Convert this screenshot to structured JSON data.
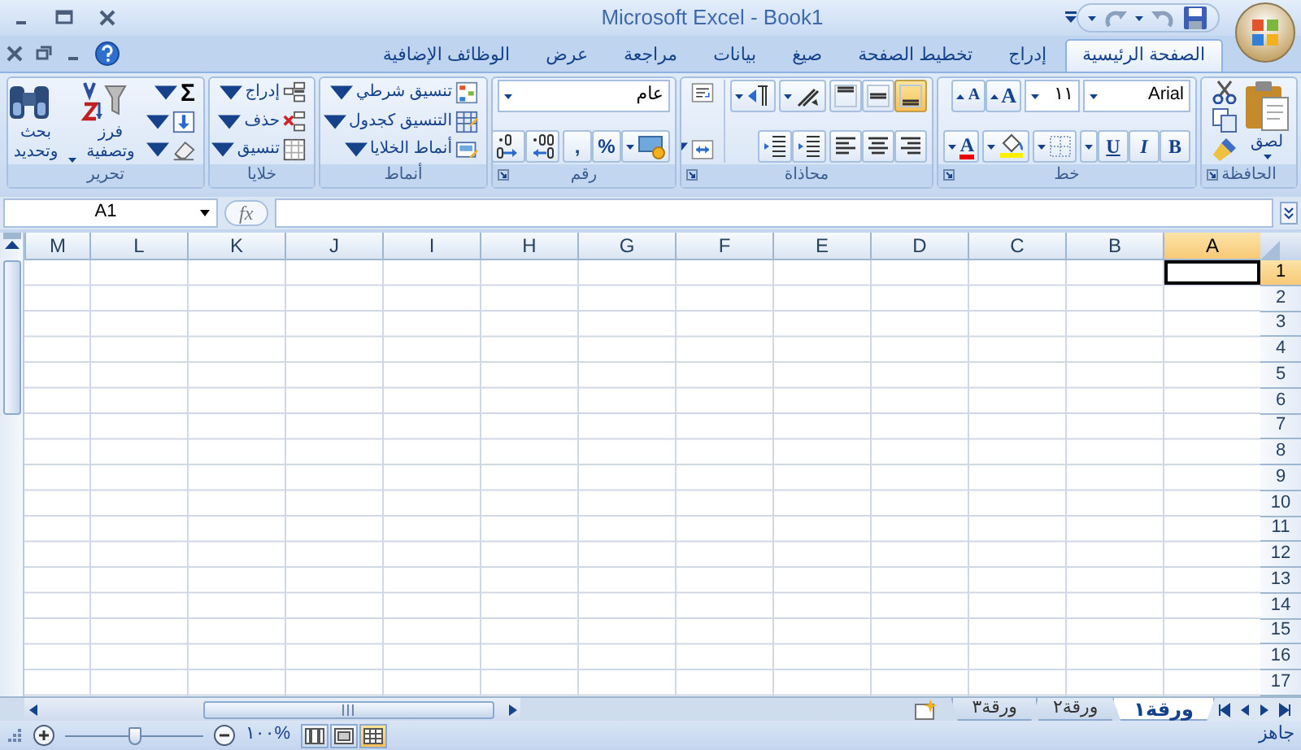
{
  "window": {
    "title": "Microsoft Excel - Book1"
  },
  "tabs": [
    {
      "label": "الصفحة الرئيسية",
      "selected": true
    },
    {
      "label": "إدراج",
      "selected": false
    },
    {
      "label": "تخطيط الصفحة",
      "selected": false
    },
    {
      "label": "صيغ",
      "selected": false
    },
    {
      "label": "بيانات",
      "selected": false
    },
    {
      "label": "مراجعة",
      "selected": false
    },
    {
      "label": "عرض",
      "selected": false
    },
    {
      "label": "الوظائف الإضافية",
      "selected": false
    }
  ],
  "ribbon": [
    {
      "kind": "clipboard",
      "title": "الحافظة",
      "paste_label": "لصق"
    },
    {
      "kind": "font",
      "title": "خط",
      "font_name": "Arial",
      "font_size": "١١",
      "grow_label": "A",
      "shrink_label": "A",
      "bold": "B",
      "italic": "I",
      "underline": "U",
      "font_color_label": "A"
    },
    {
      "kind": "alignment",
      "title": "محاذاة",
      "vertical_align": [
        {
          "kind": "bottom",
          "selected": true
        },
        {
          "kind": "middle",
          "selected": false
        },
        {
          "kind": "top",
          "selected": false
        }
      ],
      "horizontal_align": [
        {
          "kind": "right",
          "selected": false
        },
        {
          "kind": "center",
          "selected": false
        },
        {
          "kind": "left",
          "selected": false
        }
      ]
    },
    {
      "kind": "number",
      "title": "رقم",
      "format": "عام",
      "percent": "%",
      "comma": ","
    },
    {
      "kind": "styles",
      "title": "أنماط",
      "items": [
        "تنسيق شرطي",
        "التنسيق كجدول",
        "أنماط الخلايا"
      ]
    },
    {
      "kind": "cells",
      "title": "خلايا",
      "items": [
        "إدراج",
        "حذف",
        "تنسيق"
      ]
    },
    {
      "kind": "editing",
      "title": "تحرير",
      "sum": "Σ",
      "sort_label": "فرز وتصفية",
      "find_label": "بحث وتحديد"
    }
  ],
  "formula_bar": {
    "name_box": "A1",
    "fx": "fx"
  },
  "columns": [
    {
      "label": "A",
      "selected": true
    },
    {
      "label": "B",
      "selected": false
    },
    {
      "label": "C",
      "selected": false
    },
    {
      "label": "D",
      "selected": false
    },
    {
      "label": "E",
      "selected": false
    },
    {
      "label": "F",
      "selected": false
    },
    {
      "label": "G",
      "selected": false
    },
    {
      "label": "H",
      "selected": false
    },
    {
      "label": "I",
      "selected": false
    },
    {
      "label": "J",
      "selected": false
    },
    {
      "label": "K",
      "selected": false
    },
    {
      "label": "L",
      "selected": false
    },
    {
      "label": "M",
      "selected": false
    }
  ],
  "rows": [
    {
      "label": "1",
      "selected": true
    },
    {
      "label": "2",
      "selected": false
    },
    {
      "label": "3",
      "selected": false
    },
    {
      "label": "4",
      "selected": false
    },
    {
      "label": "5",
      "selected": false
    },
    {
      "label": "6",
      "selected": false
    },
    {
      "label": "7",
      "selected": false
    },
    {
      "label": "8",
      "selected": false
    },
    {
      "label": "9",
      "selected": false
    },
    {
      "label": "10",
      "selected": false
    },
    {
      "label": "11",
      "selected": false
    },
    {
      "label": "12",
      "selected": false
    },
    {
      "label": "13",
      "selected": false
    },
    {
      "label": "14",
      "selected": false
    },
    {
      "label": "15",
      "selected": false
    },
    {
      "label": "16",
      "selected": false
    },
    {
      "label": "17",
      "selected": false
    }
  ],
  "sheet_tabs": [
    {
      "label": "ورقة١",
      "selected": true
    },
    {
      "label": "ورقة٢",
      "selected": false
    },
    {
      "label": "ورقة٣",
      "selected": false
    }
  ],
  "status_bar": {
    "status": "جاهز",
    "zoom": "%١٠٠",
    "zoom_slider": {
      "level": 0.5
    },
    "views": [
      {
        "kind": "normal",
        "selected": true
      },
      {
        "kind": "page-layout",
        "selected": false
      },
      {
        "kind": "page-break",
        "selected": false
      }
    ]
  }
}
